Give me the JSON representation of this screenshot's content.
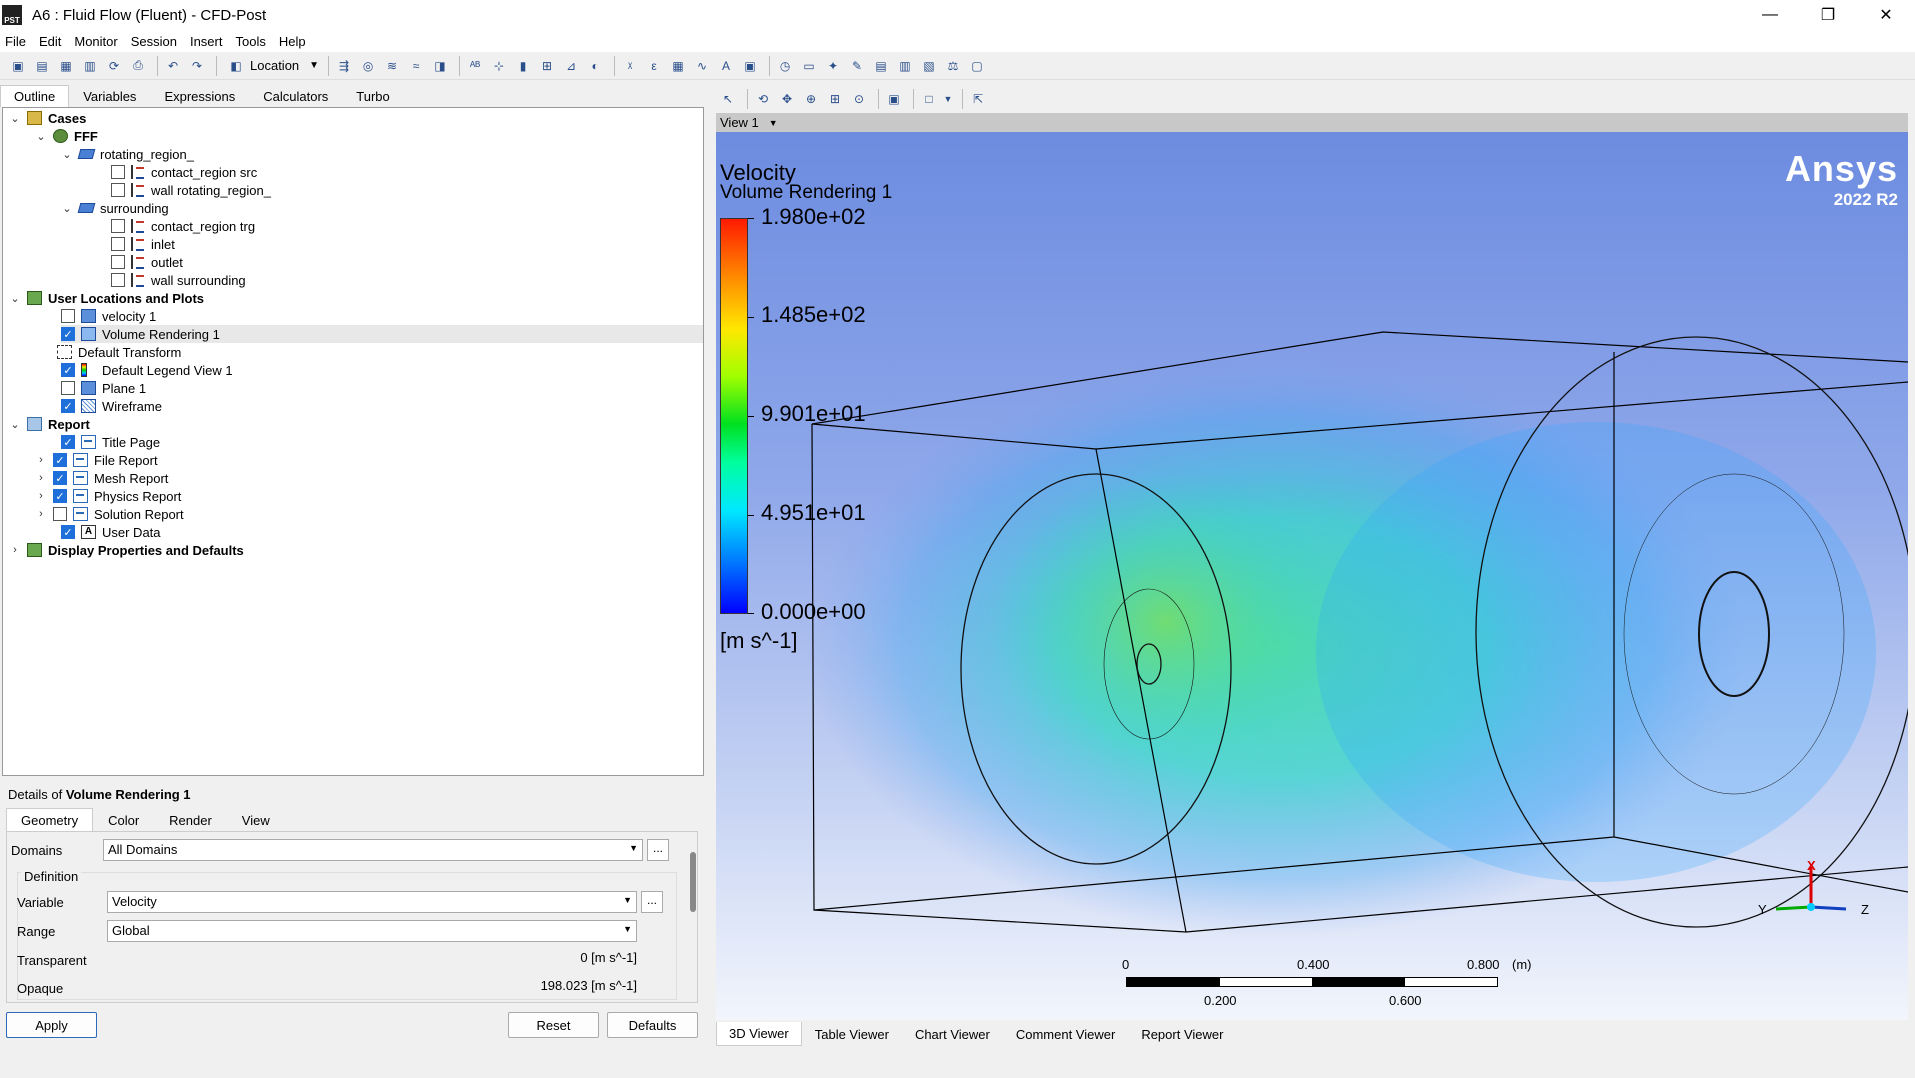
{
  "window": {
    "title": "A6 : Fluid Flow (Fluent) - CFD-Post",
    "app_icon_text": "PST"
  },
  "menu": [
    "File",
    "Edit",
    "Monitor",
    "Session",
    "Insert",
    "Tools",
    "Help"
  ],
  "toolbar": {
    "location_label": "Location"
  },
  "outline_tabs": [
    "Outline",
    "Variables",
    "Expressions",
    "Calculators",
    "Turbo"
  ],
  "tree": {
    "cases": "Cases",
    "fff": "FFF",
    "rotating_region": "rotating_region_",
    "contact_src": "contact_region src",
    "wall_rotating": "wall rotating_region_",
    "surrounding": "surrounding",
    "contact_trg": "contact_region trg",
    "inlet": "inlet",
    "outlet": "outlet",
    "wall_surrounding": "wall surrounding",
    "user_locations": "User Locations and Plots",
    "velocity1": "velocity 1",
    "volume_rendering": "Volume Rendering 1",
    "default_transform": "Default Transform",
    "default_legend": "Default Legend View 1",
    "plane1": "Plane 1",
    "wireframe": "Wireframe",
    "report": "Report",
    "title_page": "Title Page",
    "file_report": "File Report",
    "mesh_report": "Mesh Report",
    "physics_report": "Physics Report",
    "solution_report": "Solution Report",
    "user_data": "User Data",
    "display_props": "Display Properties and Defaults"
  },
  "details": {
    "prefix": "Details of ",
    "object": "Volume Rendering 1",
    "tabs": [
      "Geometry",
      "Color",
      "Render",
      "View"
    ],
    "domains_label": "Domains",
    "domains_value": "All Domains",
    "definition_label": "Definition",
    "variable_label": "Variable",
    "variable_value": "Velocity",
    "range_label": "Range",
    "range_value": "Global",
    "transparent_label": "Transparent",
    "transparent_value": "0 [m s^-1]",
    "opaque_label": "Opaque",
    "opaque_value": "198.023 [m s^-1]",
    "ellipsis": "...",
    "apply": "Apply",
    "reset": "Reset",
    "defaults": "Defaults"
  },
  "viewer": {
    "view_name": "View 1",
    "legend_title": "Velocity",
    "legend_subtitle": "Volume Rendering 1",
    "legend_values": [
      "1.980e+02",
      "1.485e+02",
      "9.901e+01",
      "4.951e+01",
      "0.000e+00"
    ],
    "units": "[m s^-1]",
    "brand": "Ansys",
    "version": "2022 R2",
    "scale_top": [
      "0",
      "0.400",
      "0.800",
      "(m)"
    ],
    "scale_bottom": [
      "0.200",
      "0.600"
    ],
    "axis_x": "X",
    "axis_y": "Y",
    "axis_z": "Z"
  },
  "bottom_tabs": [
    "3D Viewer",
    "Table Viewer",
    "Chart Viewer",
    "Comment Viewer",
    "Report Viewer"
  ]
}
